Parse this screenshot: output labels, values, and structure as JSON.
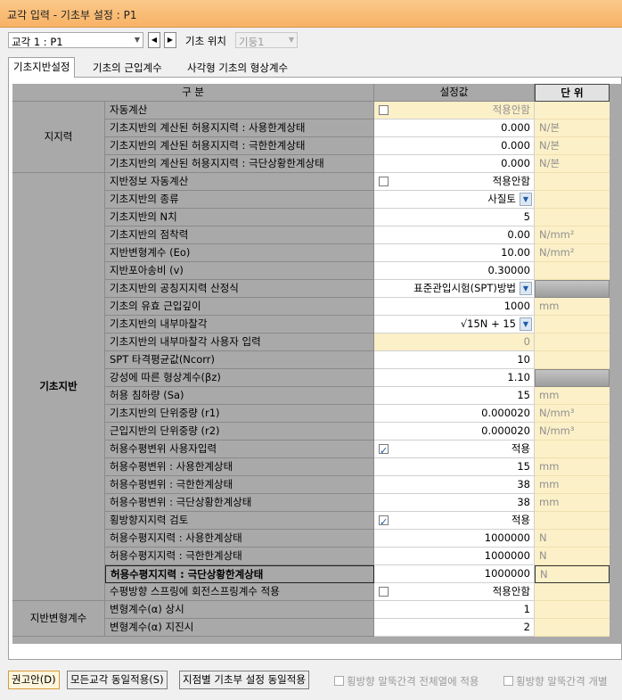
{
  "window": {
    "title": "교각 입력 - 기초부 설정 : P1"
  },
  "toolbar": {
    "pier_select": "교각 1 : P1",
    "pos_label": "기초 위치",
    "pos_select": "기둥1"
  },
  "tabs": [
    "기초지반설정",
    "기초의 근입계수",
    "사각형 기초의 형상계수"
  ],
  "grid": {
    "header": {
      "category": "구  분",
      "value": "설정값",
      "unit": "단  위"
    },
    "groups": [
      "지지력",
      "기초지반",
      "지반변형계수"
    ],
    "rows": [
      {
        "item": "자동계산",
        "value": "적용안함",
        "unit": "",
        "checkbox": false
      },
      {
        "item": "기초지반의 계산된 허용지지력 : 사용한계상태",
        "value": "0.000",
        "unit": "N/본"
      },
      {
        "item": "기초지반의 계산된 허용지지력 : 극한한계상태",
        "value": "0.000",
        "unit": "N/본"
      },
      {
        "item": "기초지반의 계산된 허용지지력 : 극단상황한계상태",
        "value": "0.000",
        "unit": "N/본"
      },
      {
        "item": "지반정보 자동계산",
        "value": "적용안함",
        "unit": "",
        "checkbox": false
      },
      {
        "item": "기초지반의 종류",
        "value": "사질토",
        "unit": "",
        "dropdown": true
      },
      {
        "item": "기초지반의 N치",
        "value": "5",
        "unit": ""
      },
      {
        "item": "기초지반의 점착력",
        "value": "0.00",
        "unit": "N/mm²"
      },
      {
        "item": "지반변형계수 (Eo)",
        "value": "10.00",
        "unit": "N/mm²"
      },
      {
        "item": "지반포아송비 (v)",
        "value": "0.30000",
        "unit": ""
      },
      {
        "item": "기초지반의 공칭지지력 산정식",
        "value": "표준관입시험(SPT)방법",
        "unit": "",
        "dropdown": true
      },
      {
        "item": "기초의 유효 근입깊이",
        "value": "1000",
        "unit": "mm"
      },
      {
        "item": "기초지반의 내부마찰각",
        "value": "√15N + 15",
        "unit": "",
        "dropdown": true
      },
      {
        "item": "기초지반의 내부마찰각 사용자 입력",
        "value": "0",
        "unit": ""
      },
      {
        "item": "SPT 타격평균값(Ncorr)",
        "value": "10",
        "unit": ""
      },
      {
        "item": "강성에 따른 형상계수(βz)",
        "value": "1.10",
        "unit": ""
      },
      {
        "item": "허용 침하량 (Sa)",
        "value": "15",
        "unit": "mm"
      },
      {
        "item": "기초지반의 단위중량 (r1)",
        "value": "0.000020",
        "unit": "N/mm³"
      },
      {
        "item": "근입지반의 단위중량 (r2)",
        "value": "0.000020",
        "unit": "N/mm³"
      },
      {
        "item": "허용수평변위 사용자입력",
        "value": "적용",
        "unit": "",
        "checkbox": true
      },
      {
        "item": "허용수평변위 : 사용한계상태",
        "value": "15",
        "unit": "mm"
      },
      {
        "item": "허용수평변위 : 극한한계상태",
        "value": "38",
        "unit": "mm"
      },
      {
        "item": "허용수평변위 : 극단상황한계상태",
        "value": "38",
        "unit": "mm"
      },
      {
        "item": "횡방향지지력 검토",
        "value": "적용",
        "unit": "",
        "checkbox": true
      },
      {
        "item": "허용수평지지력 : 사용한계상태",
        "value": "1000000",
        "unit": "N"
      },
      {
        "item": "허용수평지지력 : 극한한계상태",
        "value": "1000000",
        "unit": "N"
      },
      {
        "item": "허용수평지지력 : 극단상황한계상태",
        "value": "1000000",
        "unit": "N"
      },
      {
        "item": "수평방향 스프링에 회전스프링계수 적용",
        "value": "적용안함",
        "unit": "",
        "checkbox": false
      },
      {
        "item": "변형계수(α) 상시",
        "value": "1",
        "unit": ""
      },
      {
        "item": "변형계수(α) 지진시",
        "value": "2",
        "unit": ""
      }
    ]
  },
  "bottom": {
    "buttons": [
      "권고안(D)",
      "모든교각 동일적용(S)",
      "지점별 기초부 설정 동일적용"
    ],
    "checks": [
      "횡방향 말뚝간격 전체열에 적용",
      "횡방향 말뚝간격 개별"
    ]
  }
}
